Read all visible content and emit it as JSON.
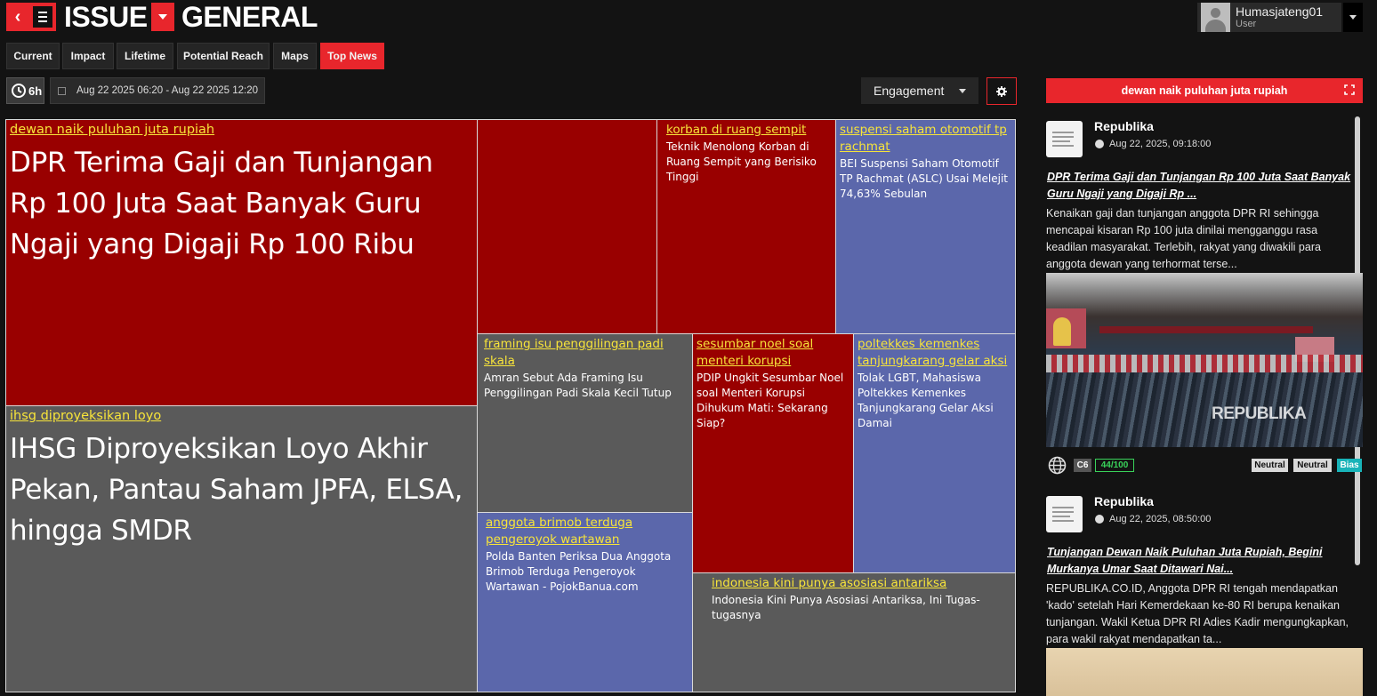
{
  "header": {
    "title_part1": "ISSUE",
    "title_part2": "GENERAL",
    "user_name": "Humasjateng01",
    "user_role": "User"
  },
  "tabs": [
    {
      "label": "Current",
      "active": false
    },
    {
      "label": "Impact",
      "active": false
    },
    {
      "label": "Lifetime",
      "active": false
    },
    {
      "label": "Potential Reach",
      "active": false
    },
    {
      "label": "Maps",
      "active": false
    },
    {
      "label": "Top News",
      "active": true
    }
  ],
  "toolbar": {
    "range_label": "6h",
    "date_range": "Aug 22 2025 06:20 - Aug 22 2025 12:20",
    "sort_select": "Engagement"
  },
  "treemap": [
    {
      "topic": "dewan naik puluhan juta rupiah",
      "headline": "DPR Terima Gaji dan Tunjangan Rp 100 Juta Saat Banyak Guru Ngaji yang Digaji Rp 100 Ribu",
      "color": "#990000"
    },
    {
      "topic": "ihsg diproyeksikan loyo",
      "headline": "IHSG Diproyeksikan Loyo Akhir Pekan, Pantau Saham JPFA, ELSA, hingga SMDR",
      "color": "#5a5a5a"
    },
    {
      "topic": "",
      "headline": "",
      "color": "#990000"
    },
    {
      "topic": "korban di ruang sempit",
      "headline": "Teknik Menolong Korban di Ruang Sempit yang Berisiko Tinggi",
      "color": "#990000"
    },
    {
      "topic": "suspensi saham otomotif tp rachmat",
      "headline": "BEI Suspensi Saham Otomotif TP Rachmat (ASLC) Usai Melejit 74,63% Sebulan",
      "color": "#5b67ab"
    },
    {
      "topic": "framing isu penggilingan padi skala",
      "headline": "Amran Sebut Ada Framing Isu Penggilingan Padi Skala Kecil Tutup",
      "color": "#5a5a5a"
    },
    {
      "topic": "sesumbar noel soal menteri korupsi",
      "headline": "PDIP Ungkit Sesumbar Noel soal Menteri Korupsi Dihukum Mati: Sekarang Siap?",
      "color": "#990000"
    },
    {
      "topic": "poltekkes kemenkes tanjungkarang gelar aksi",
      "headline": "Tolak LGBT, Mahasiswa Poltekkes Kemenkes Tanjungkarang Gelar Aksi Damai",
      "color": "#5b67ab"
    },
    {
      "topic": "anggota brimob terduga pengeroyok wartawan",
      "headline": "Polda Banten Periksa Dua Anggota Brimob Terduga Pengeroyok Wartawan - PojokBanua.com",
      "color": "#5b67ab"
    },
    {
      "topic": "indonesia kini punya asosiasi antariksa",
      "headline": "Indonesia Kini Punya Asosiasi Antariksa, Ini Tugas-tugasnya",
      "color": "#5a5a5a"
    }
  ],
  "right_panel": {
    "selected_topic": "dewan naik puluhan juta rupiah",
    "articles": [
      {
        "source": "Republika",
        "time": "Aug 22, 2025, 09:18:00",
        "title_line1": "DPR Terima Gaji dan Tunjangan Rp 100 Juta Saat Banyak",
        "title_line2": "Guru Ngaji yang Digaji Rp ...",
        "body_lines": [
          "Kenaikan gaji dan tunjangan anggota DPR RI sehingga",
          "mencapai kisaran Rp 100 juta dinilai mengganggu rasa",
          "keadilan masyarakat. Terlebih, rakyat yang diwakili para",
          "anggota dewan yang terhormat terse..."
        ],
        "image_watermark": "REPUBLIKA",
        "tier": "C6",
        "score": "44/100",
        "tags": [
          "Neutral",
          "Neutral",
          "Bias"
        ]
      },
      {
        "source": "Republika",
        "time": "Aug 22, 2025, 08:50:00",
        "title_line1": "Tunjangan Dewan Naik Puluhan Juta Rupiah, Begini",
        "title_line2": "Murkanya Umar Saat Ditawari Nai...",
        "body_lines": [
          "REPUBLIKA.CO.ID, Anggota DPR RI tengah mendapatkan",
          "'kado' setelah Hari Kemerdekaan ke-80 RI berupa kenaikan",
          "tunjangan. Wakil Ketua DPR RI Adies Kadir mengungkapkan,",
          "para wakil rakyat mendapatkan ta..."
        ]
      }
    ]
  },
  "colors": {
    "accent_red": "#e8262c",
    "cell_red": "#990000",
    "cell_gray": "#5a5a5a",
    "cell_blue": "#5b67ab",
    "topic_yellow": "#f7e43a",
    "score_green": "#39d35a",
    "bias_teal": "#18b3b8"
  }
}
